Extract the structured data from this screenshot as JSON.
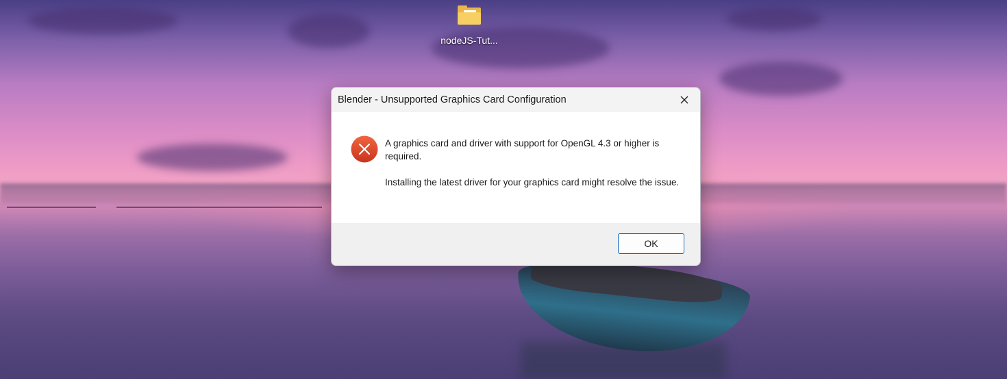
{
  "desktop": {
    "icons": [
      {
        "label": "nodeJS-Tut...",
        "icon": "folder-icon"
      }
    ]
  },
  "dialog": {
    "title": "Blender - Unsupported Graphics Card Configuration",
    "icon": "error-icon",
    "message_line1": "A graphics card and driver with support for OpenGL 4.3 or higher is required.",
    "message_line2": "Installing the latest driver for your graphics card might resolve the issue.",
    "ok_label": "OK",
    "close_icon": "close-icon"
  },
  "colors": {
    "error_red": "#d9432c",
    "accent_border": "#0f6cbd",
    "titlebar_bg": "#f3f3f3",
    "footer_bg": "#f0f0f0"
  }
}
